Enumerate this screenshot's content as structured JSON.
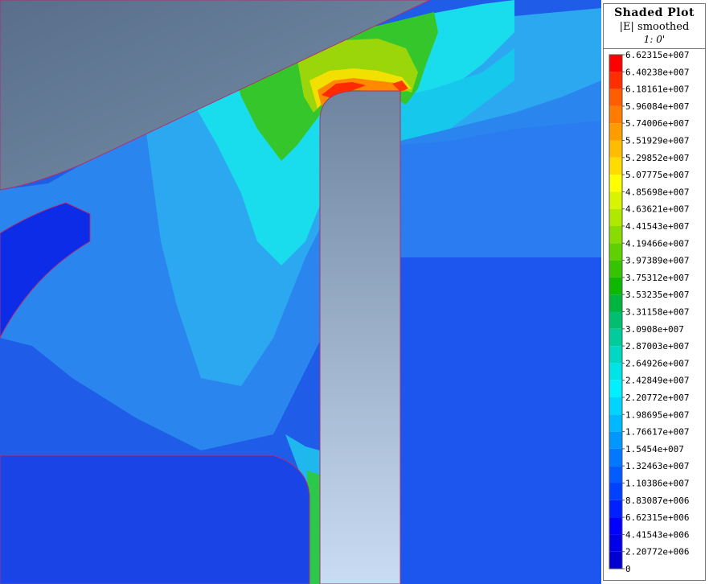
{
  "legend": {
    "title": "Shaded Plot",
    "subtitle": "|E| smoothed",
    "frame": "1: 0'",
    "labels": [
      "6.62315e+007",
      "6.40238e+007",
      "6.18161e+007",
      "5.96084e+007",
      "5.74006e+007",
      "5.51929e+007",
      "5.29852e+007",
      "5.07775e+007",
      "4.85698e+007",
      "4.63621e+007",
      "4.41543e+007",
      "4.19466e+007",
      "3.97389e+007",
      "3.75312e+007",
      "3.53235e+007",
      "3.31158e+007",
      "3.0908e+007",
      "2.87003e+007",
      "2.64926e+007",
      "2.42849e+007",
      "2.20772e+007",
      "1.98695e+007",
      "1.76617e+007",
      "1.5454e+007",
      "1.32463e+007",
      "1.10386e+007",
      "8.83087e+006",
      "6.62315e+006",
      "4.41543e+006",
      "2.20772e+006",
      "0"
    ],
    "colors": [
      "#ff0000",
      "#ff2e00",
      "#ff5c00",
      "#ff7c00",
      "#ff9c00",
      "#ffbc00",
      "#ffdc00",
      "#ffff00",
      "#d8f400",
      "#b0e800",
      "#88dc00",
      "#5fd000",
      "#36c400",
      "#0cb800",
      "#00b440",
      "#00c070",
      "#00cc9c",
      "#00d8c4",
      "#00e4e8",
      "#00f0ff",
      "#00d4ff",
      "#00b8ff",
      "#0098ff",
      "#0078ff",
      "#005cff",
      "#0040ff",
      "#0020ff",
      "#0000ff",
      "#0000e8",
      "#0000d0"
    ]
  },
  "colors": {
    "background_metal": "#5f7a96",
    "conductor_top": "#7a8ea6",
    "conductor_bottom": "#cfe0f5",
    "field_low": "#1a55ee",
    "field_mid": "#2c9cf0",
    "field_cyan": "#1fe2ea",
    "field_green": "#24c23a",
    "field_hot": "#ff5a00",
    "boundary": "#b03070"
  }
}
